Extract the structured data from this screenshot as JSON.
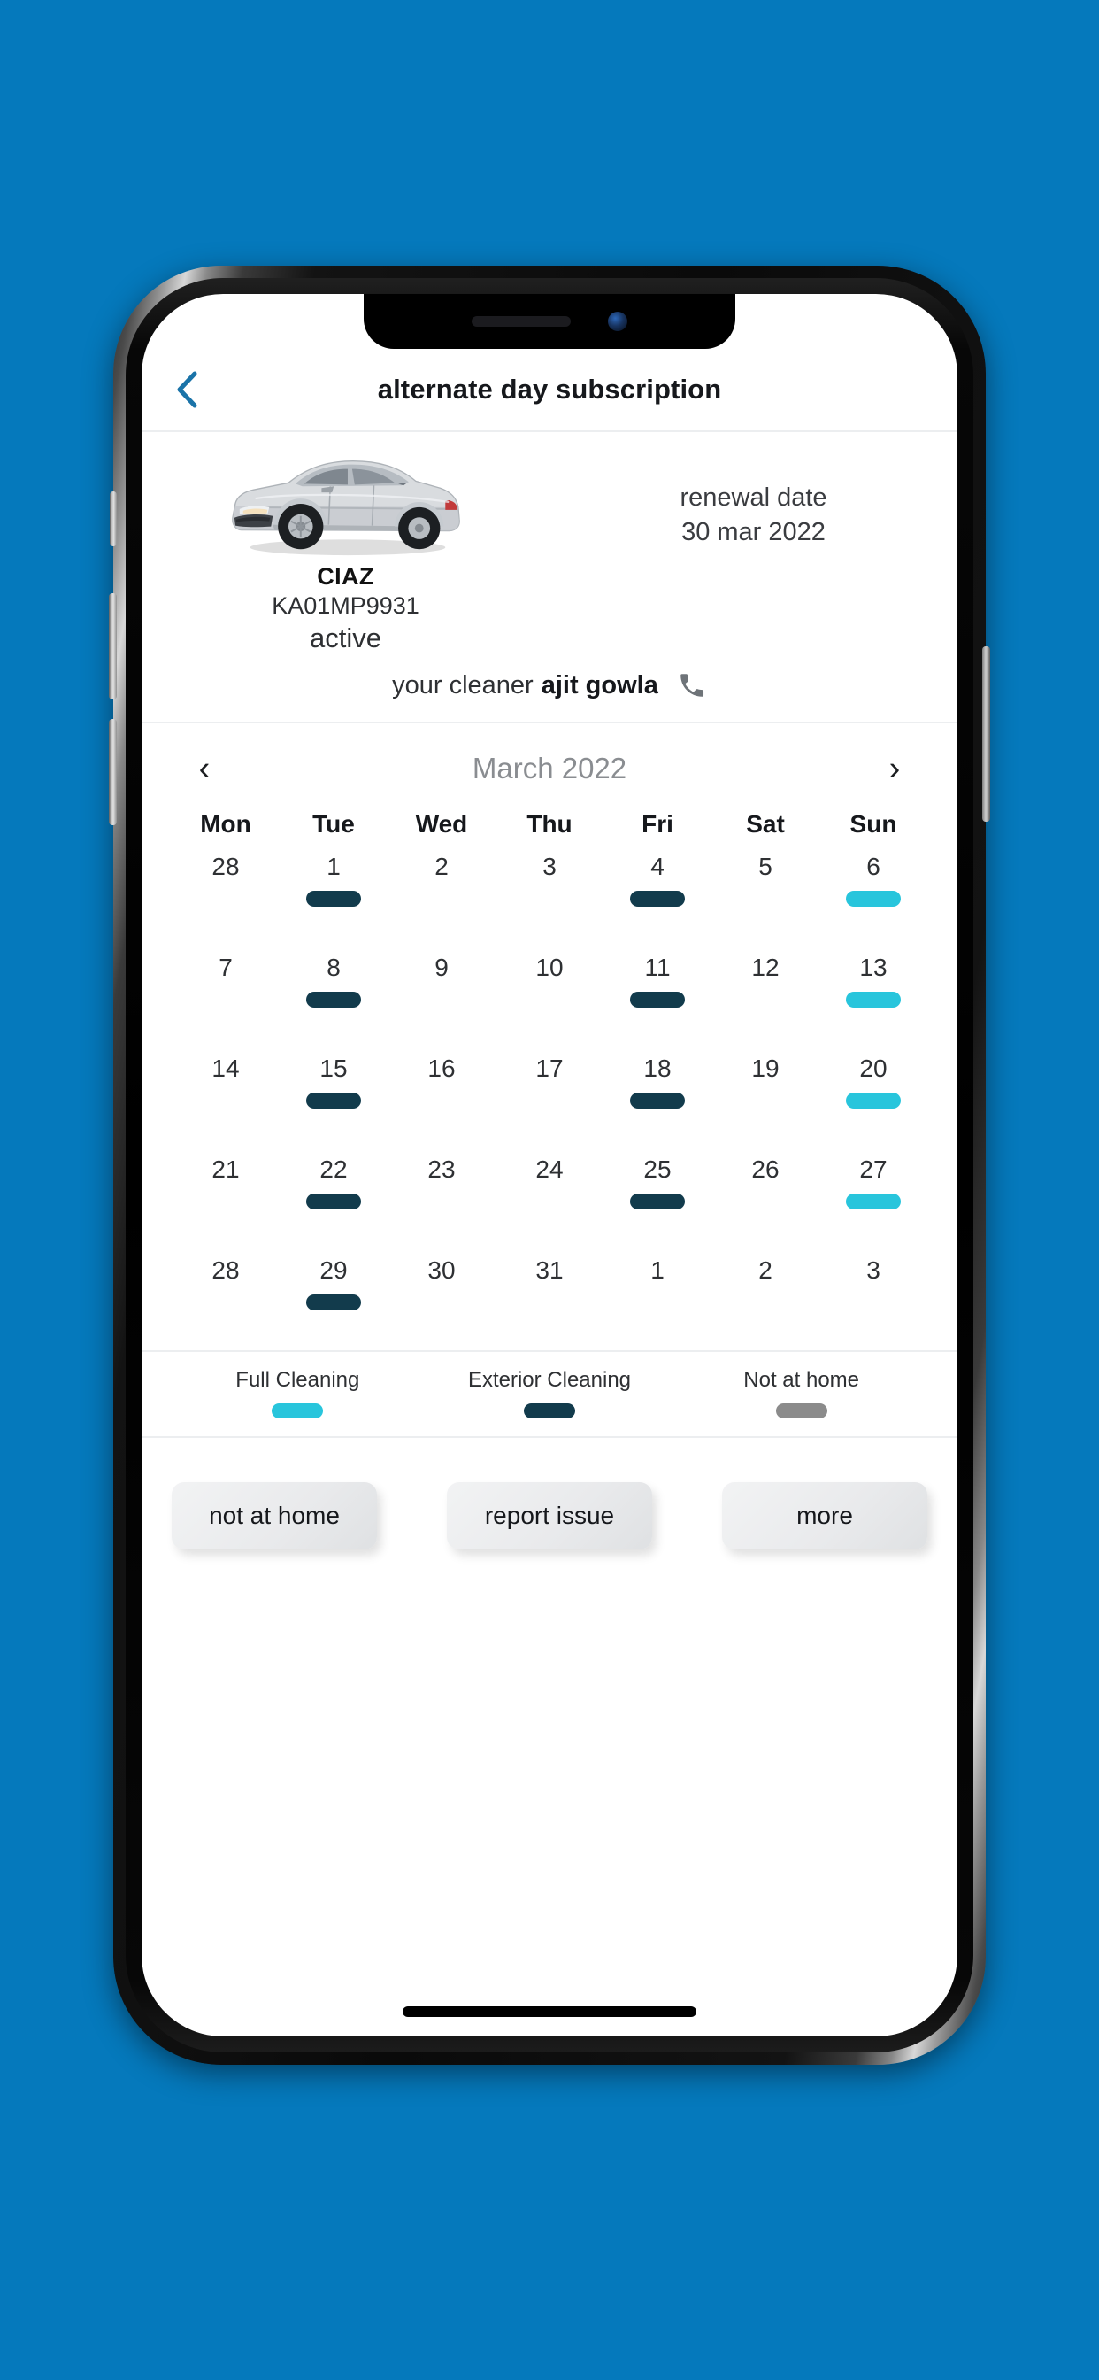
{
  "theme": {
    "background": "#0579bc",
    "accent_blue": "#1a73a8",
    "full_cleaning_color": "#28c5dc",
    "exterior_cleaning_color": "#123b4c",
    "not_at_home_color": "#8b8b8b"
  },
  "header": {
    "title": "alternate day subscription",
    "back_icon": "chevron-left-icon"
  },
  "vehicle": {
    "image_alt": "silver sedan car",
    "model": "CIAZ",
    "plate": "KA01MP9931",
    "status": "active",
    "renewal_label": "renewal date",
    "renewal_date": "30 mar 2022"
  },
  "cleaner": {
    "label": "your cleaner",
    "name": "ajit gowla",
    "call_icon": "phone-icon"
  },
  "calendar": {
    "prev_icon": "chevron-left-icon",
    "next_icon": "chevron-right-icon",
    "month_label": "March 2022",
    "weekdays": [
      "Mon",
      "Tue",
      "Wed",
      "Thu",
      "Fri",
      "Sat",
      "Sun"
    ],
    "days": [
      {
        "n": "28",
        "marker": "none",
        "other_month": true
      },
      {
        "n": "1",
        "marker": "exterior",
        "other_month": false
      },
      {
        "n": "2",
        "marker": "none",
        "other_month": false
      },
      {
        "n": "3",
        "marker": "none",
        "other_month": false
      },
      {
        "n": "4",
        "marker": "exterior",
        "other_month": false
      },
      {
        "n": "5",
        "marker": "none",
        "other_month": false
      },
      {
        "n": "6",
        "marker": "full",
        "other_month": false
      },
      {
        "n": "7",
        "marker": "none",
        "other_month": false
      },
      {
        "n": "8",
        "marker": "exterior",
        "other_month": false
      },
      {
        "n": "9",
        "marker": "none",
        "other_month": false
      },
      {
        "n": "10",
        "marker": "none",
        "other_month": false
      },
      {
        "n": "11",
        "marker": "exterior",
        "other_month": false
      },
      {
        "n": "12",
        "marker": "none",
        "other_month": false
      },
      {
        "n": "13",
        "marker": "full",
        "other_month": false
      },
      {
        "n": "14",
        "marker": "none",
        "other_month": false
      },
      {
        "n": "15",
        "marker": "exterior",
        "other_month": false
      },
      {
        "n": "16",
        "marker": "none",
        "other_month": false
      },
      {
        "n": "17",
        "marker": "none",
        "other_month": false
      },
      {
        "n": "18",
        "marker": "exterior",
        "other_month": false
      },
      {
        "n": "19",
        "marker": "none",
        "other_month": false
      },
      {
        "n": "20",
        "marker": "full",
        "other_month": false
      },
      {
        "n": "21",
        "marker": "none",
        "other_month": false
      },
      {
        "n": "22",
        "marker": "exterior",
        "other_month": false
      },
      {
        "n": "23",
        "marker": "none",
        "other_month": false
      },
      {
        "n": "24",
        "marker": "none",
        "other_month": false
      },
      {
        "n": "25",
        "marker": "exterior",
        "other_month": false
      },
      {
        "n": "26",
        "marker": "none",
        "other_month": false
      },
      {
        "n": "27",
        "marker": "full",
        "other_month": false
      },
      {
        "n": "28",
        "marker": "none",
        "other_month": false
      },
      {
        "n": "29",
        "marker": "exterior",
        "other_month": false
      },
      {
        "n": "30",
        "marker": "none",
        "other_month": false
      },
      {
        "n": "31",
        "marker": "none",
        "other_month": false
      },
      {
        "n": "1",
        "marker": "none",
        "other_month": true
      },
      {
        "n": "2",
        "marker": "none",
        "other_month": true
      },
      {
        "n": "3",
        "marker": "none",
        "other_month": true
      }
    ]
  },
  "legend": [
    {
      "label": "Full Cleaning",
      "color": "#28c5dc"
    },
    {
      "label": "Exterior Cleaning",
      "color": "#123b4c"
    },
    {
      "label": "Not at home",
      "color": "#8b8b8b"
    }
  ],
  "actions": [
    {
      "label": "not at home"
    },
    {
      "label": "report issue"
    },
    {
      "label": "more"
    }
  ]
}
